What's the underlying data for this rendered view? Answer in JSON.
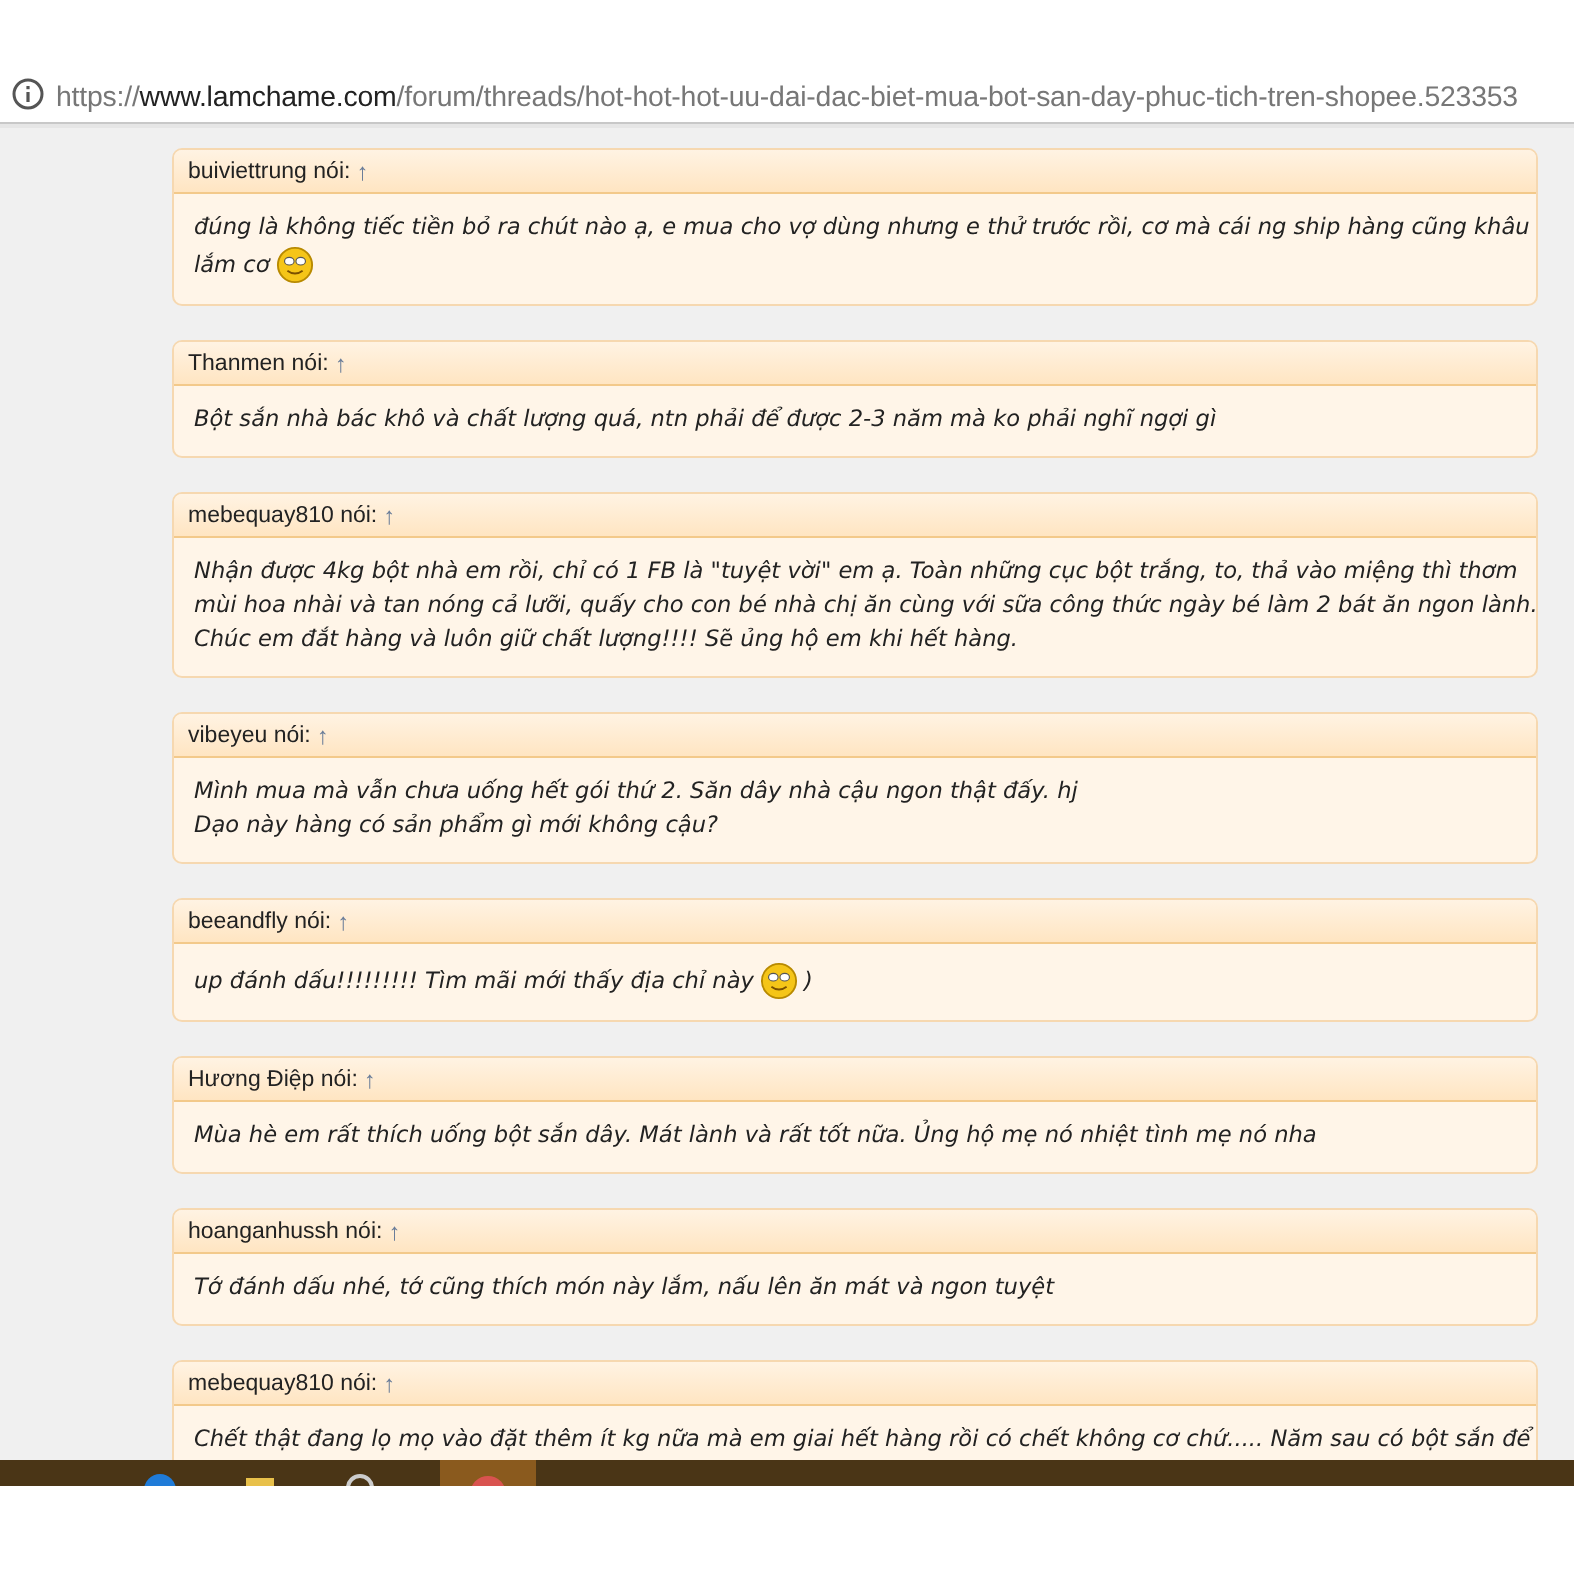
{
  "address_bar": {
    "scheme": "https://",
    "host": "www.lamchame.com",
    "path": "/forum/threads/hot-hot-hot-uu-dai-dac-biet-mua-bot-san-day-phuc-tich-tren-shopee.523353"
  },
  "quotes": [
    {
      "author": "buiviettrung nói:",
      "arrow": "↑",
      "lines": [
        [
          {
            "kind": "text",
            "text": "đúng là không tiếc tiền bỏ ra chút nào ạ, e mua cho vợ dùng nhưng e thử trước rồi, cơ mà cái ng ship hàng cũng khâu"
          }
        ],
        [
          {
            "kind": "text",
            "text": "lắm cơ"
          },
          {
            "kind": "smiley"
          }
        ]
      ]
    },
    {
      "author": "Thanmen nói:",
      "arrow": "↑",
      "lines": [
        [
          {
            "kind": "text",
            "text": "Bột sắn nhà bác khô và chất lượng quá, ntn phải để được 2-3 năm mà ko phải nghĩ ngợi gì"
          }
        ]
      ]
    },
    {
      "author": "mebequay810 nói:",
      "arrow": "↑",
      "lines": [
        [
          {
            "kind": "text",
            "text": "Nhận được 4kg bột nhà em rồi, chỉ có 1 FB là \"tuyệt vời\" em ạ. Toàn những cục bột trắng, to, thả vào miệng thì thơm"
          }
        ],
        [
          {
            "kind": "text",
            "text": "mùi hoa nhài và tan nóng cả lưỡi, quấy cho con bé nhà chị ăn cùng với sữa công thức ngày bé làm 2 bát ăn ngon lành."
          }
        ],
        [
          {
            "kind": "text",
            "text": "Chúc em đắt hàng và luôn giữ chất lượng!!!! Sẽ ủng hộ em khi hết hàng."
          }
        ]
      ]
    },
    {
      "author": "vibeyeu nói:",
      "arrow": "↑",
      "lines": [
        [
          {
            "kind": "text",
            "text": "Mình mua mà vẫn chưa uống hết gói thứ 2. Săn dây nhà cậu ngon thật đấy. hj"
          }
        ],
        [
          {
            "kind": "text",
            "text": "Dạo này hàng có sản phẩm gì mới không cậu?"
          }
        ]
      ]
    },
    {
      "author": "beeandfly nói:",
      "arrow": "↑",
      "lines": [
        [
          {
            "kind": "text",
            "text": "up đánh dấu!!!!!!!!! Tìm mãi mới thấy địa chỉ này"
          },
          {
            "kind": "smiley"
          },
          {
            "kind": "text",
            "text": ")"
          }
        ]
      ]
    },
    {
      "author": "Hương Điệp nói:",
      "arrow": "↑",
      "lines": [
        [
          {
            "kind": "text",
            "text": "Mùa hè em rất thích uống bột sắn dây. Mát lành và rất tốt nữa. Ủng hộ mẹ nó nhiệt tình mẹ nó nha"
          }
        ]
      ]
    },
    {
      "author": "hoanganhussh nói:",
      "arrow": "↑",
      "lines": [
        [
          {
            "kind": "text",
            "text": "Tớ đánh dấu nhé, tớ cũng thích món này lắm, nấu lên ăn mát và ngon tuyệt"
          }
        ]
      ]
    },
    {
      "author": "mebequay810 nói:",
      "arrow": "↑",
      "lines": [
        [
          {
            "kind": "text",
            "text": "Chết thật đang lọ mọ vào đặt thêm ít kg nữa mà em giai hết hàng rồi có chết không cơ chứ..... Năm sau có bột sắn để"
          }
        ]
      ]
    }
  ]
}
